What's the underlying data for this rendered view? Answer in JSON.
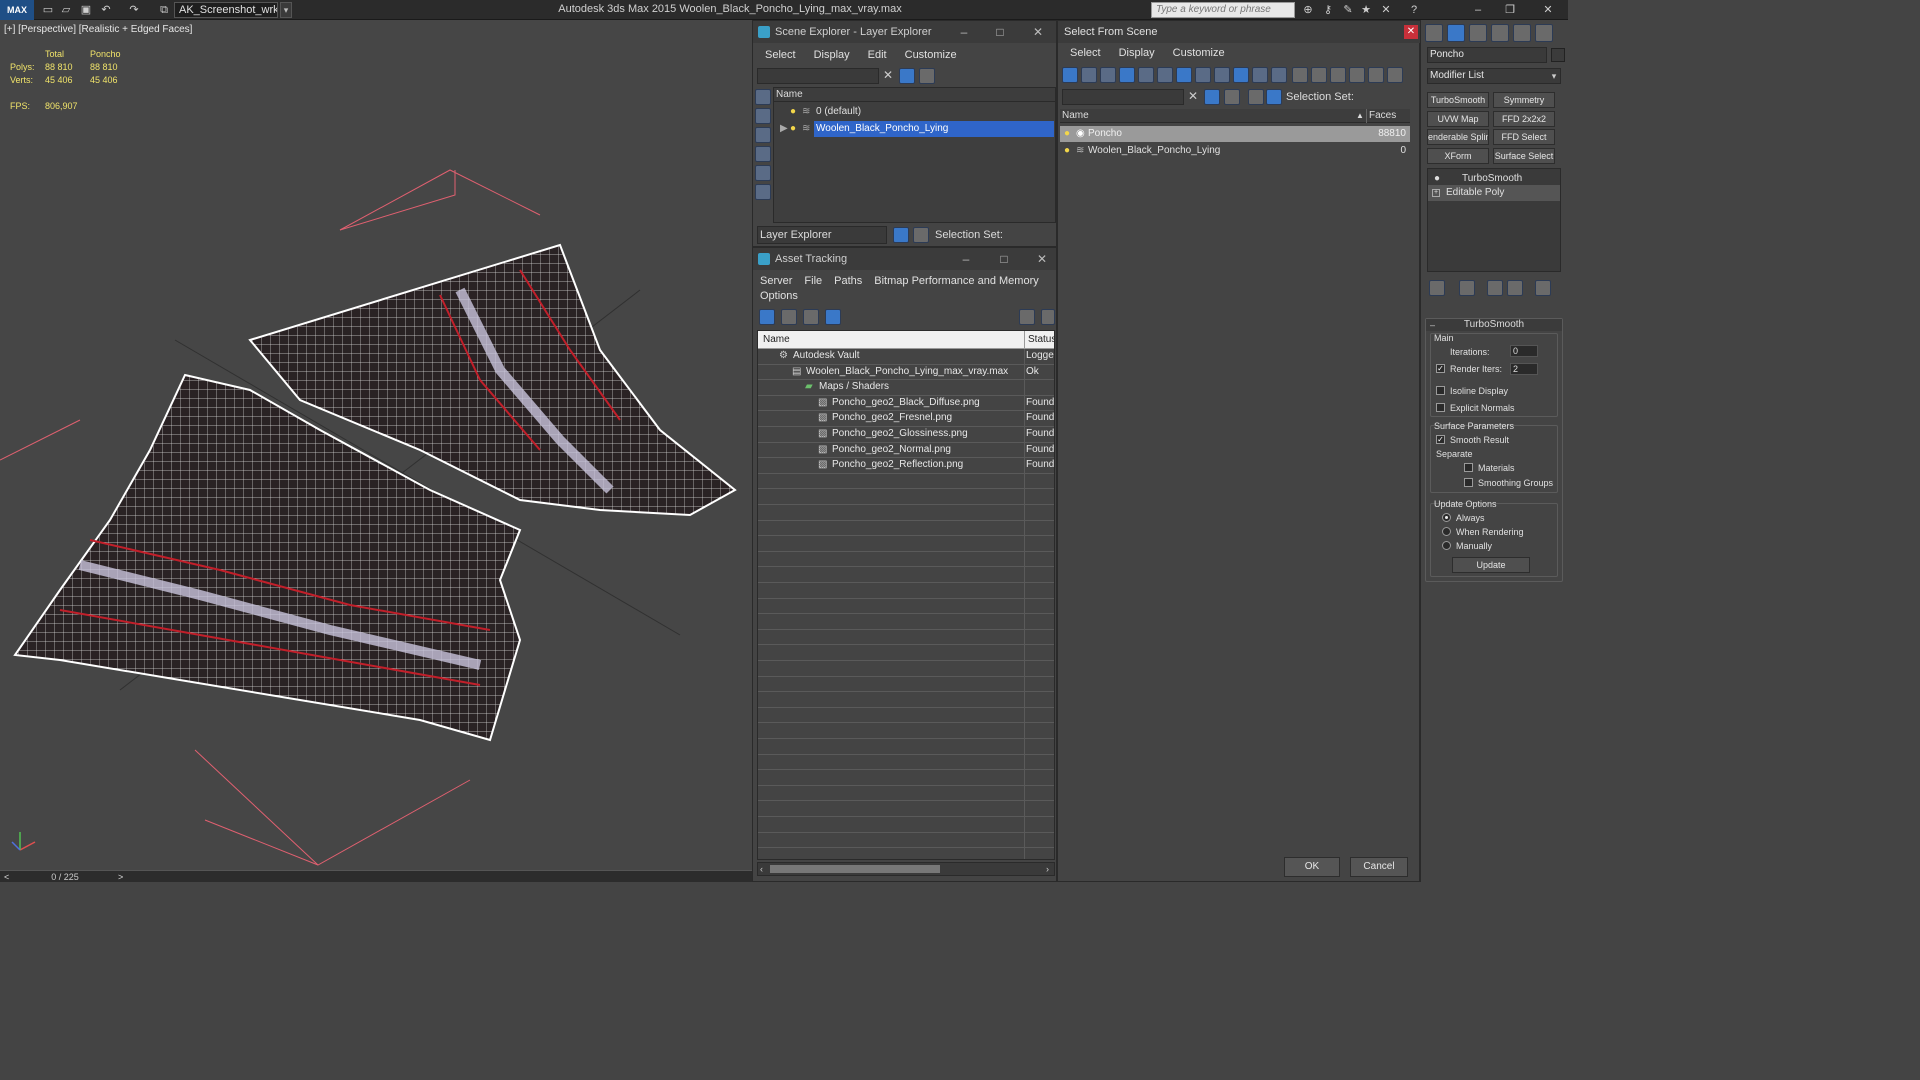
{
  "titlebar": {
    "logo": "MAX",
    "workspace": "AK_Screenshot_wrksp",
    "app_title": "Autodesk 3ds Max  2015     Woolen_Black_Poncho_Lying_max_vray.max",
    "search_placeholder": "Type a keyword or phrase"
  },
  "viewport": {
    "label": "[+] [Perspective] [Realistic + Edged Faces]",
    "stats": {
      "headers": [
        "",
        "Total",
        "Poncho"
      ],
      "rows": [
        [
          "Polys:",
          "88 810",
          "88 810"
        ],
        [
          "Verts:",
          "45 406",
          "45 406"
        ]
      ],
      "fps_label": "FPS:",
      "fps_value": "806,907"
    },
    "time_display": "0 / 225",
    "time_prev": "<",
    "time_next": ">"
  },
  "scene_explorer": {
    "title": "Scene Explorer - Layer Explorer",
    "menu": [
      "Select",
      "Display",
      "Edit",
      "Customize"
    ],
    "column_name": "Name",
    "layers": [
      {
        "label": "0 (default)",
        "selected": false
      },
      {
        "label": "Woolen_Black_Poncho_Lying",
        "selected": true
      }
    ],
    "footer_dropdown": "Layer Explorer",
    "footer_selection_set": "Selection Set:"
  },
  "asset_tracking": {
    "title": "Asset Tracking",
    "menu": [
      "Server",
      "File",
      "Paths",
      "Bitmap Performance and Memory"
    ],
    "menu2": [
      "Options"
    ],
    "columns": {
      "name": "Name",
      "status": "Status"
    },
    "rows": [
      {
        "name": "Autodesk Vault",
        "status": "Logged",
        "indent": 1
      },
      {
        "name": "Woolen_Black_Poncho_Lying_max_vray.max",
        "status": "Ok",
        "indent": 2
      },
      {
        "name": "Maps / Shaders",
        "status": "",
        "indent": 3
      },
      {
        "name": "Poncho_geo2_Black_Diffuse.png",
        "status": "Found",
        "indent": 4
      },
      {
        "name": "Poncho_geo2_Fresnel.png",
        "status": "Found",
        "indent": 4
      },
      {
        "name": "Poncho_geo2_Glossiness.png",
        "status": "Found",
        "indent": 4
      },
      {
        "name": "Poncho_geo2_Normal.png",
        "status": "Found",
        "indent": 4
      },
      {
        "name": "Poncho_geo2_Reflection.png",
        "status": "Found",
        "indent": 4
      }
    ],
    "empty_rows": 25
  },
  "select_from_scene": {
    "title": "Select From Scene",
    "menu": [
      "Select",
      "Display",
      "Customize"
    ],
    "selection_set": "Selection Set:",
    "columns": {
      "name": "Name",
      "faces": "Faces"
    },
    "rows": [
      {
        "name": "Poncho",
        "faces": "88810",
        "selected": true
      },
      {
        "name": "Woolen_Black_Poncho_Lying",
        "faces": "0",
        "selected": false
      }
    ],
    "ok": "OK",
    "cancel": "Cancel"
  },
  "command_panel": {
    "object_name": "Poncho",
    "modifier_list": "Modifier List",
    "buttons": [
      [
        "TurboSmooth",
        "Symmetry"
      ],
      [
        "UVW Map",
        "FFD 2x2x2"
      ],
      [
        "enderable Splin",
        "FFD Select"
      ],
      [
        "XForm",
        "Surface Select"
      ]
    ],
    "stack": [
      "TurboSmooth",
      "Editable Poly"
    ],
    "rollout_title": "TurboSmooth",
    "main_label": "Main",
    "iterations_label": "Iterations:",
    "iterations_value": "0",
    "render_iters_label": "Render Iters:",
    "render_iters_value": "2",
    "isoline": "Isoline Display",
    "explicit_normals": "Explicit Normals",
    "surface_params": "Surface Parameters",
    "smooth_result": "Smooth Result",
    "separate": "Separate",
    "materials": "Materials",
    "smoothing_groups": "Smoothing Groups",
    "update_options": "Update Options",
    "always": "Always",
    "when_rendering": "When Rendering",
    "manually": "Manually",
    "update": "Update"
  }
}
